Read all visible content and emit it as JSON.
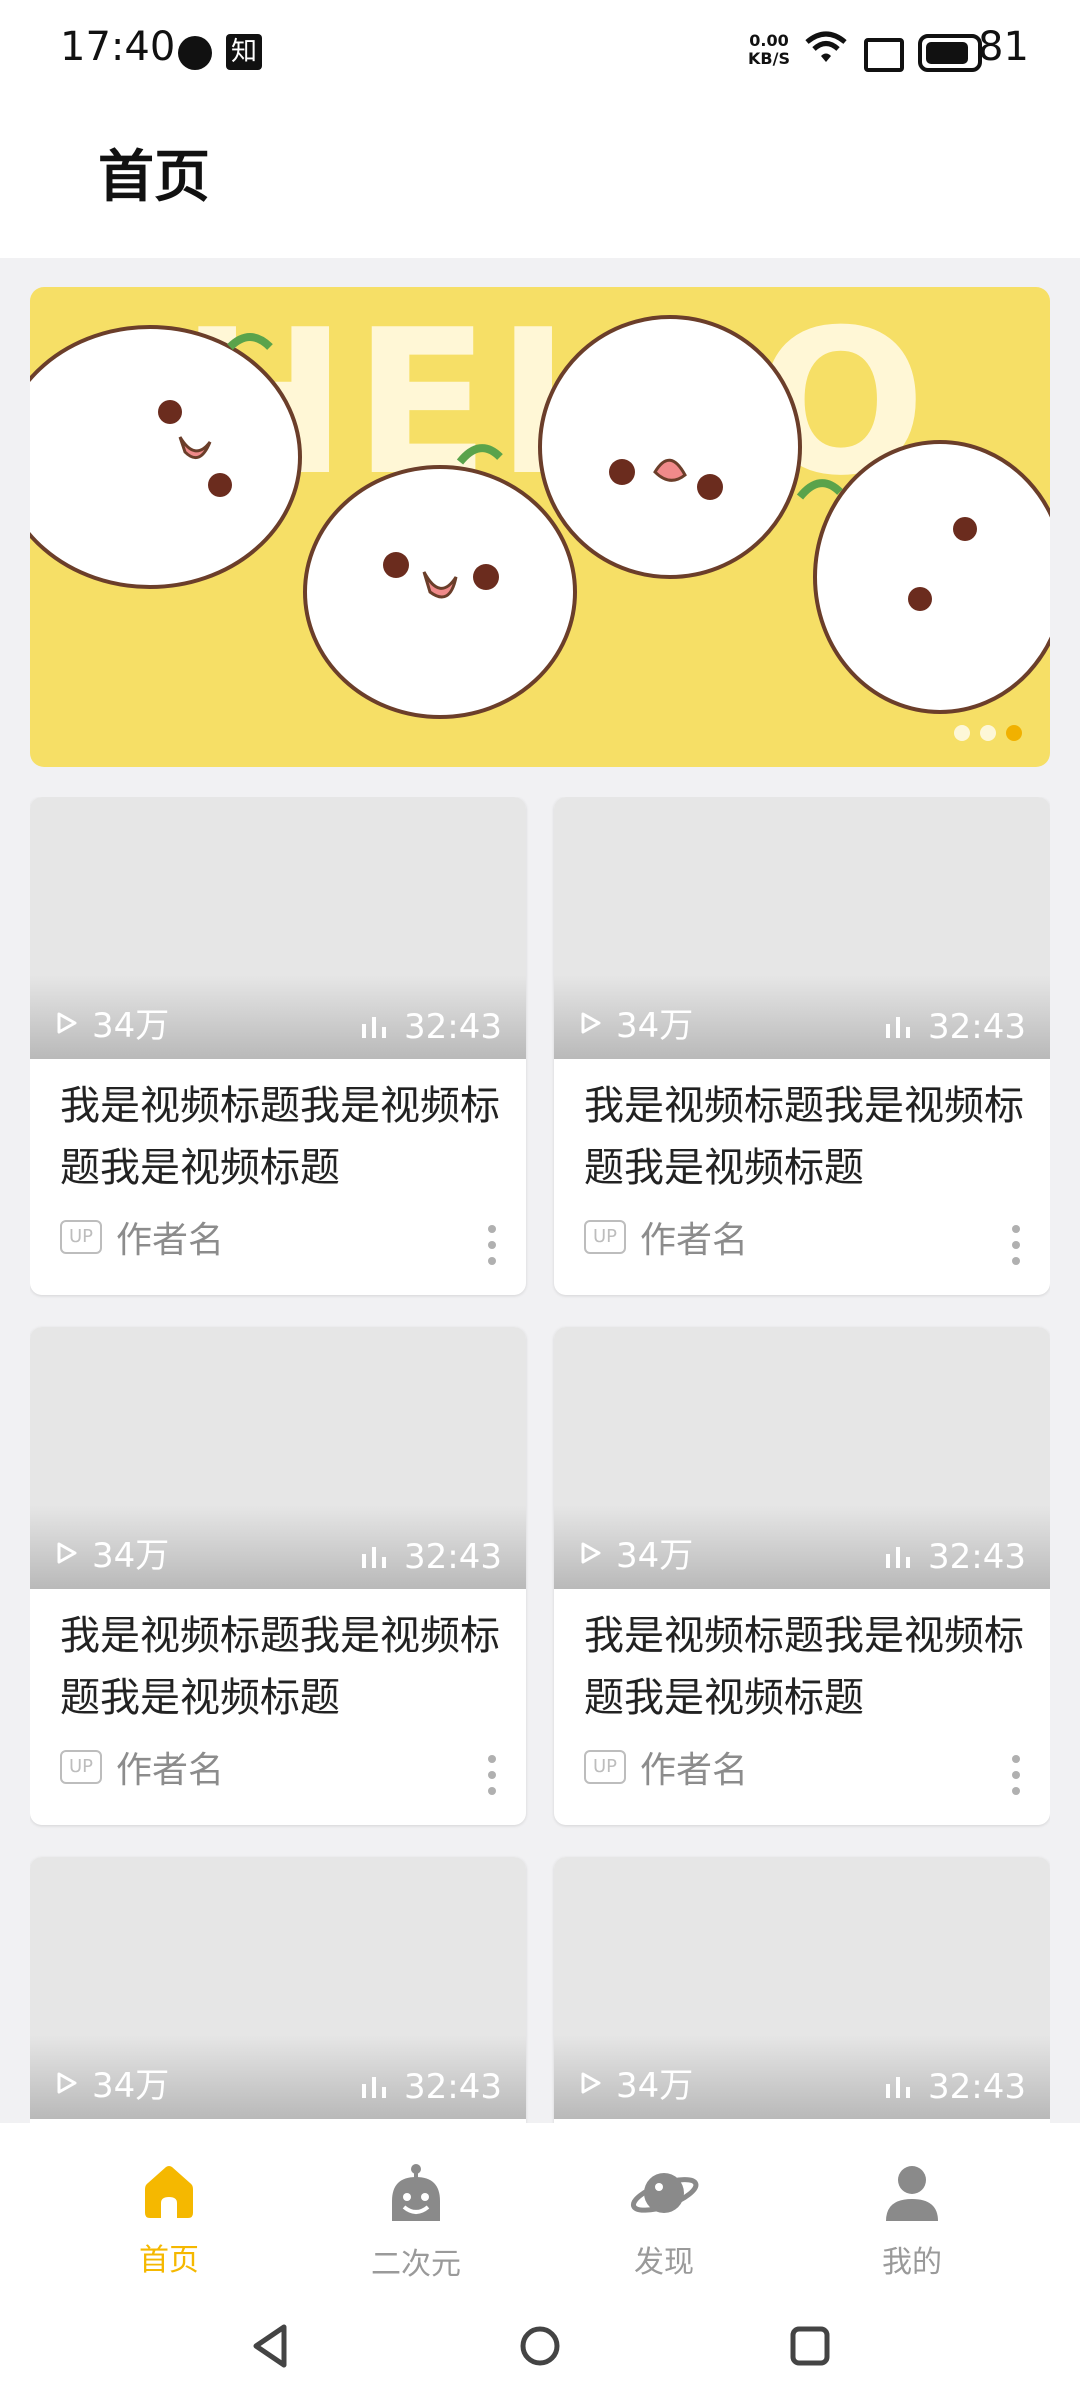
{
  "status": {
    "time": "17:40",
    "app_badge": "知",
    "net_speed_value": "0.00",
    "net_speed_unit": "KB/S",
    "battery": "81"
  },
  "header": {
    "title": "首页"
  },
  "banner": {
    "headline": "HELLO",
    "dots": 3,
    "active_dot": 2
  },
  "cards": [
    {
      "plays": "34万",
      "duration": "32:43",
      "title": "我是视频标题我是视频标题我是视频标题",
      "badge": "UP",
      "author": "作者名"
    },
    {
      "plays": "34万",
      "duration": "32:43",
      "title": "我是视频标题我是视频标题我是视频标题",
      "badge": "UP",
      "author": "作者名"
    },
    {
      "plays": "34万",
      "duration": "32:43",
      "title": "我是视频标题我是视频标题我是视频标题",
      "badge": "UP",
      "author": "作者名"
    },
    {
      "plays": "34万",
      "duration": "32:43",
      "title": "我是视频标题我是视频标题我是视频标题",
      "badge": "UP",
      "author": "作者名"
    },
    {
      "plays": "34万",
      "duration": "32:43",
      "title": "",
      "badge": "",
      "author": ""
    },
    {
      "plays": "34万",
      "duration": "32:43",
      "title": "",
      "badge": "",
      "author": ""
    }
  ],
  "nav": {
    "items": [
      {
        "label": "首页",
        "icon": "home-icon",
        "active": true
      },
      {
        "label": "二次元",
        "icon": "mascot-icon",
        "active": false
      },
      {
        "label": "发现",
        "icon": "planet-icon",
        "active": false
      },
      {
        "label": "我的",
        "icon": "person-icon",
        "active": false
      }
    ]
  },
  "colors": {
    "accent": "#f5b800",
    "banner_bg": "#f6df66",
    "inactive": "#9a9a9a"
  }
}
